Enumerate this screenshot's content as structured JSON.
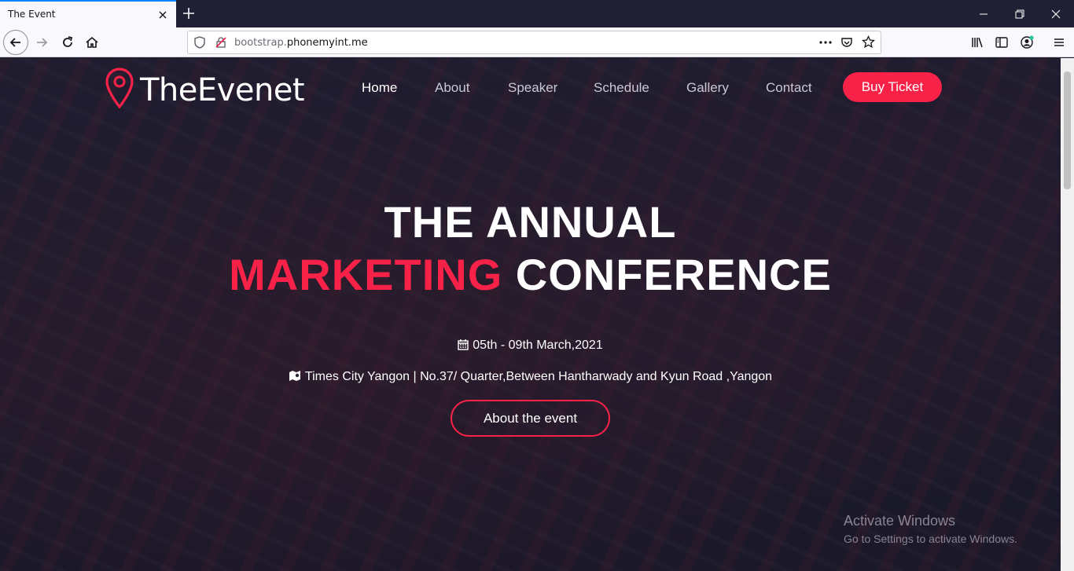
{
  "browser": {
    "tab_title": "The Event",
    "url_prefix": "bootstrap.",
    "url_host": "phonemyint.me"
  },
  "site": {
    "logo_text": "TheEvenet",
    "menu": [
      "Home",
      "About",
      "Speaker",
      "Schedule",
      "Gallery",
      "Contact"
    ],
    "buy_ticket": "Buy Ticket"
  },
  "hero": {
    "line1": "THE ANNUAL",
    "line2_accent": "MARKETING",
    "line2_rest": " CONFERENCE",
    "date": "05th - 09th March,2021",
    "location": "Times City Yangon | No.37/ Quarter,Between Hantharwady and Kyun Road ,Yangon",
    "cta": "About the event"
  },
  "watermark": {
    "title": "Activate Windows",
    "subtitle": "Go to Settings to activate Windows."
  },
  "colors": {
    "accent": "#f82249",
    "tab_accent": "#0a84ff"
  }
}
